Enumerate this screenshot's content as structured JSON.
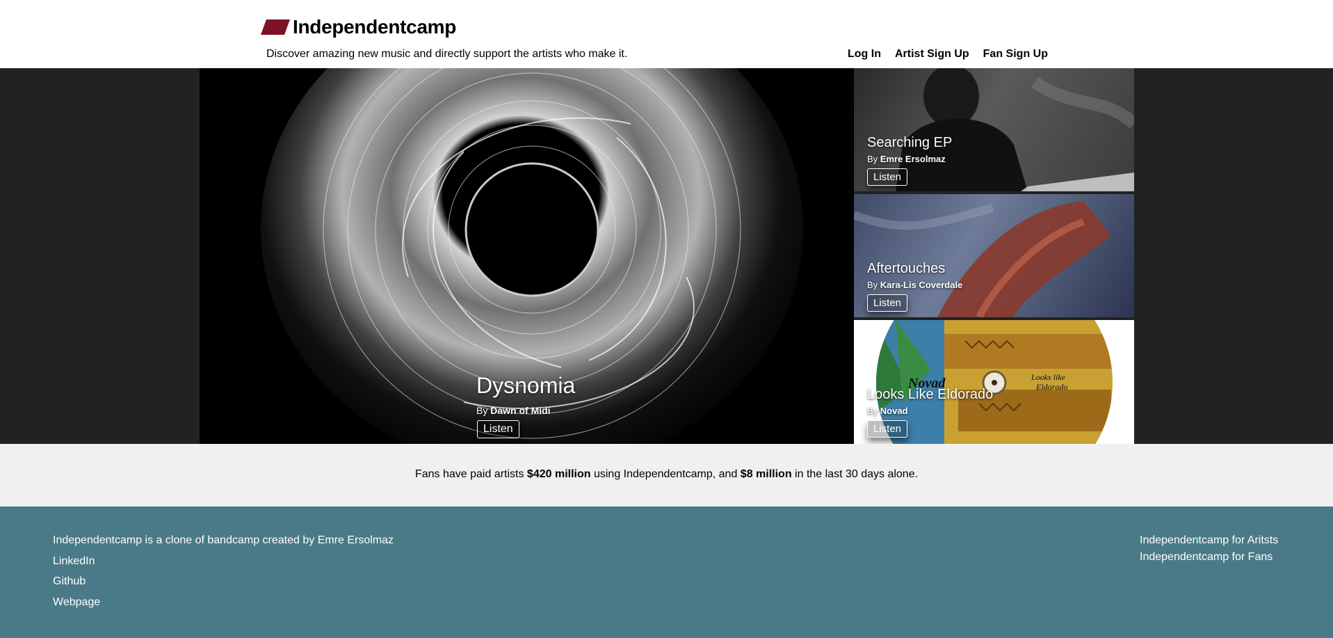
{
  "brand": {
    "name": "Independentcamp",
    "tagline": "Discover amazing new music and directly support the artists who make it.",
    "color": "#7a1327"
  },
  "nav": {
    "login": "Log In",
    "artist_signup": "Artist Sign Up",
    "fan_signup": "Fan Sign Up"
  },
  "featured": {
    "title": "Dysnomia",
    "by": "By",
    "artist": "Dawn of Midi",
    "listen": "Listen"
  },
  "side": [
    {
      "title": "Searching EP",
      "by": "By",
      "artist": "Emre Ersolmaz",
      "listen": "Listen"
    },
    {
      "title": "Aftertouches",
      "by": "By",
      "artist": "Kara-Lis Coverdale",
      "listen": "Listen"
    },
    {
      "title": "Looks Like Eldorado",
      "by": "By",
      "artist": "Novad",
      "listen": "Listen",
      "cover_text_1": "Novad",
      "cover_text_2": "Looks like",
      "cover_text_3": "Eldorado"
    }
  ],
  "stats": {
    "p1": "Fans have paid artists ",
    "amount1": "$420 million",
    "p2": " using Independentcamp, and ",
    "amount2": "$8 million",
    "p3": " in the last 30 days alone."
  },
  "footer": {
    "credit": "Independentcamp is a clone of bandcamp created by Emre Ersolmaz",
    "linkedin": "LinkedIn",
    "github": "Github",
    "webpage": "Webpage",
    "for_artists": "Independentcamp for Aritsts",
    "for_fans": "Independentcamp for Fans"
  },
  "colors": {
    "footer_bg": "#4a7a88",
    "stats_bg": "#f0f0f0",
    "hero_bg": "#222222"
  }
}
